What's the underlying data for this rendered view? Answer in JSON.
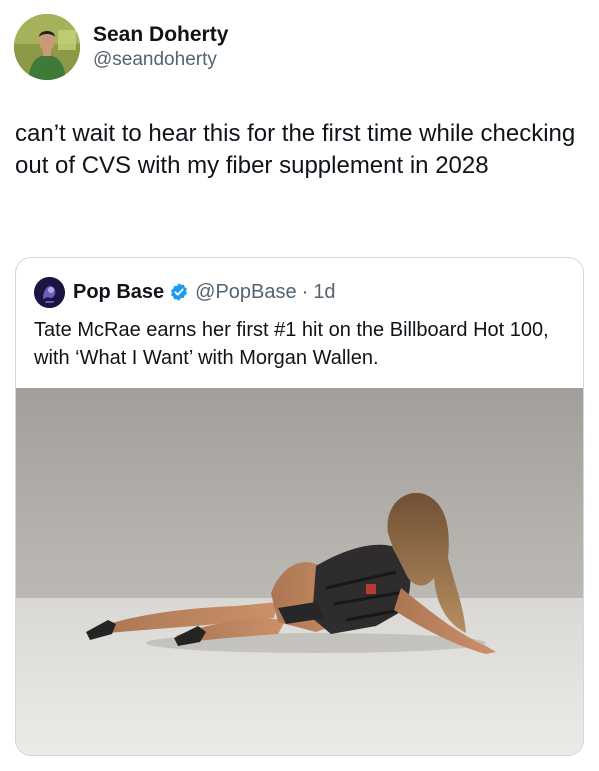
{
  "tweet": {
    "author": {
      "display_name": "Sean Doherty",
      "handle": "@seandoherty"
    },
    "text": "can’t wait to hear this for the first time while checking out of CVS with my fiber supplement in 2028"
  },
  "quoted_tweet": {
    "author": {
      "display_name": "Pop Base",
      "handle": "@PopBase",
      "verified": true,
      "verified_icon": "verified-badge-icon"
    },
    "separator": "·",
    "time": "1d",
    "text": "Tate McRae earns her first #1 hit on the Billboard Hot 100, with ‘What I Want’ with Morgan Wallen."
  },
  "colors": {
    "text_primary": "#0f1419",
    "text_secondary": "#536471",
    "border": "#cfd9de",
    "verified_blue": "#1d9bf0",
    "studio_wall": "#a9a6a1",
    "studio_floor": "#e9e7e3"
  }
}
